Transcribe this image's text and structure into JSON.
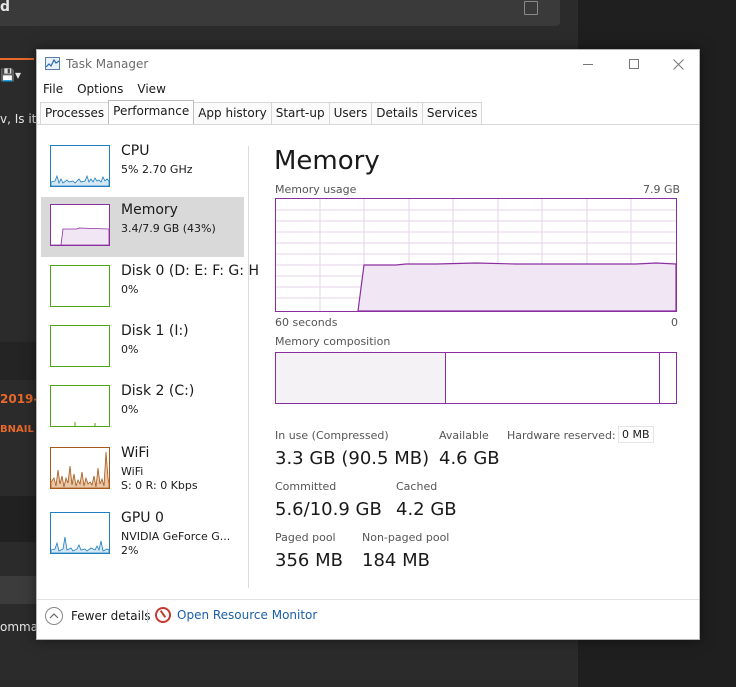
{
  "background_app": {
    "title_fragment": "d",
    "text_fragment": "v, Is it",
    "date_fragment": "2019-",
    "thumbnail_fragment": "BNAIL",
    "command_fragment": "omma"
  },
  "window": {
    "title": "Task Manager",
    "menu": [
      "File",
      "Options",
      "View"
    ],
    "tabs": [
      "Processes",
      "Performance",
      "App history",
      "Start-up",
      "Users",
      "Details",
      "Services"
    ],
    "active_tab": "Performance"
  },
  "sidebar": {
    "items": [
      {
        "name": "CPU",
        "sub1": "5%  2.70 GHz",
        "sub2": "",
        "color": "#1f7fc0",
        "selected": false
      },
      {
        "name": "Memory",
        "sub1": "3.4/7.9 GB (43%)",
        "sub2": "",
        "color": "#8b2fa0",
        "selected": true
      },
      {
        "name": "Disk 0 (D: E: F: G: H",
        "sub1": "0%",
        "sub2": "",
        "color": "#4da619",
        "selected": false
      },
      {
        "name": "Disk 1 (I:)",
        "sub1": "0%",
        "sub2": "",
        "color": "#4da619",
        "selected": false
      },
      {
        "name": "Disk 2 (C:)",
        "sub1": "0%",
        "sub2": "",
        "color": "#4da619",
        "selected": false
      },
      {
        "name": "WiFi",
        "sub1": "WiFi",
        "sub2": "S: 0  R: 0 Kbps",
        "color": "#a7591b",
        "selected": false
      },
      {
        "name": "GPU 0",
        "sub1": "NVIDIA GeForce G...",
        "sub2": "2%",
        "color": "#1f7fc0",
        "selected": false
      }
    ]
  },
  "main": {
    "title": "Memory",
    "usage_label": "Memory usage",
    "usage_max": "7.9 GB",
    "time_left": "60 seconds",
    "time_right": "0",
    "composition_label": "Memory composition",
    "stats": {
      "in_use_label": "In use (Compressed)",
      "in_use_value": "3.3 GB (90.5 MB)",
      "available_label": "Available",
      "available_value": "4.6 GB",
      "reserved_label": "Hardware reserved:",
      "reserved_value": "0 MB",
      "committed_label": "Committed",
      "committed_value": "5.6/10.9 GB",
      "cached_label": "Cached",
      "cached_value": "4.2 GB",
      "paged_label": "Paged pool",
      "paged_value": "356 MB",
      "nonpaged_label": "Non-paged pool",
      "nonpaged_value": "184 MB"
    }
  },
  "footer": {
    "fewer_details": "Fewer details",
    "resource_monitor": "Open Resource Monitor"
  },
  "colors": {
    "memory_accent": "#8b2fa0",
    "cpu_accent": "#1f7fc0",
    "disk_accent": "#4da619",
    "wifi_accent": "#a7591b",
    "link": "#1b5fa8",
    "bg_orange": "#e8692c"
  }
}
